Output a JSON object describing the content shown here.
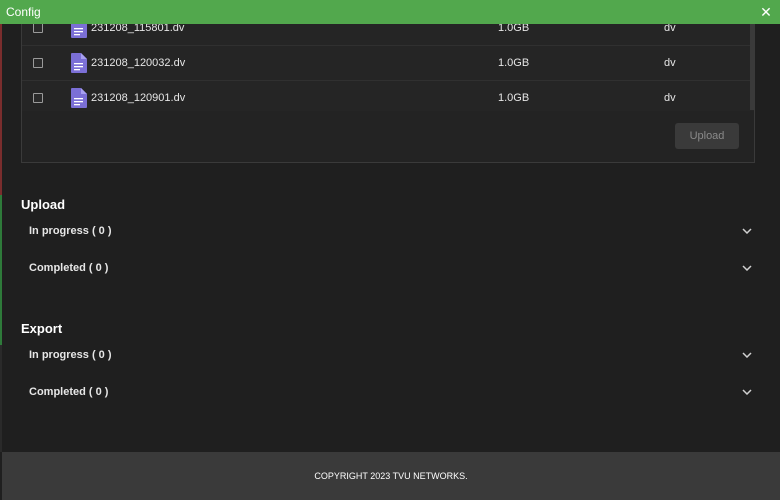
{
  "window": {
    "title": "Config",
    "close_symbol": "✕"
  },
  "files": [
    {
      "name": "231208_115801.dv",
      "size": "1.0GB",
      "type": "dv"
    },
    {
      "name": "231208_120032.dv",
      "size": "1.0GB",
      "type": "dv"
    },
    {
      "name": "231208_120901.dv",
      "size": "1.0GB",
      "type": "dv"
    }
  ],
  "file_panel": {
    "upload_label": "Upload"
  },
  "upload_section": {
    "title": "Upload",
    "in_progress": "In progress ( 0 )",
    "completed": "Completed ( 0 )"
  },
  "export_section": {
    "title": "Export",
    "in_progress": "In progress ( 0 )",
    "completed": "Completed ( 0 )"
  },
  "footer": {
    "copyright": "COPYRIGHT 2023 TVU NETWORKS."
  },
  "colors": {
    "title_bar": "#52a84d",
    "file_icon": "#7b6fd6",
    "background": "#1f1f1f"
  }
}
